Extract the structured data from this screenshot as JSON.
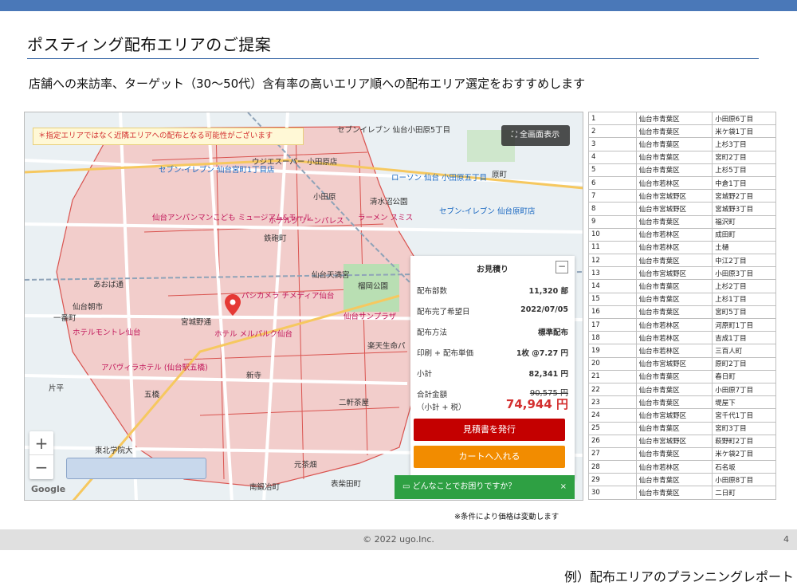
{
  "slide": {
    "title": "ポスティング配布エリアのご提案",
    "subtitle": "店舗への来訪率、ターゲット（30〜50代）含有率の高いエリア順への配布エリア選定をおすすめします",
    "note": "※条件により価格は変動します",
    "copyright": "© 2022 ugo.Inc.",
    "page_number": "4",
    "caption": "例）配布エリアのプランニングレポート",
    "accent_color": "#4a78b8"
  },
  "map": {
    "warning": "＊指定エリアではなく近隣エリアへの配布となる可能性がございます",
    "fullscreen_label": "全画面表示",
    "zoom_in": "+",
    "zoom_out": "−",
    "google_logo": "Google",
    "labels": [
      "セブンイレブン 仙台小田原5丁目",
      "ウジエスーパー 小田原店",
      "小田原",
      "清水沼公園",
      "ローソン 仙台 小田原五丁目",
      "原町",
      "セブン-イレブン 仙台宮町1丁目店",
      "仙台アンパンマンこども ミュージアム&モール",
      "ホテルグリーンパレス",
      "ラーメン スミス",
      "セブン-イレブン 仙台原町店",
      "榴岡公園",
      "仙台天満宮",
      "パシカメラ チメディア仙台",
      "宮城野通",
      "ホテル メルパルク仙台",
      "仙台サンプラザ",
      "ホテルモントレ仙台",
      "アパヴィラホテル (仙台駅五橋)",
      "楽天生命パ",
      "新寺",
      "二軒茶屋",
      "五橋",
      "東北学院大",
      "元茶畑",
      "表柴田町",
      "南鍛冶町",
      "一番町",
      "あおば通",
      "片平",
      "仙台朝市",
      "鉄砲町"
    ]
  },
  "quote": {
    "title": "お見積り",
    "minimize": "−",
    "rows": [
      {
        "label": "配布部数",
        "value": "11,320 部"
      },
      {
        "label": "配布完了希望日",
        "value": "2022/07/05"
      },
      {
        "label": "配布方法",
        "value": "標準配布"
      },
      {
        "label": "印刷 + 配布単価",
        "value": "1枚 @7.27 円"
      },
      {
        "label": "小計",
        "value": "82,341 円"
      }
    ],
    "total_label": "合計金額",
    "total_sub": "（小計 + 税）",
    "total_old": "90,575 円",
    "total": "74,944 円",
    "issue_button": "見積書を発行",
    "cart_button": "カートへ入れる",
    "help": "どんなことでお困りですか？",
    "help_close": "×"
  },
  "areas": [
    [
      "1",
      "仙台市青葉区",
      "小田原6丁目"
    ],
    [
      "2",
      "仙台市青葉区",
      "米ケ袋1丁目"
    ],
    [
      "3",
      "仙台市青葉区",
      "上杉3丁目"
    ],
    [
      "4",
      "仙台市青葉区",
      "宮町2丁目"
    ],
    [
      "5",
      "仙台市青葉区",
      "上杉5丁目"
    ],
    [
      "6",
      "仙台市若林区",
      "中倉1丁目"
    ],
    [
      "7",
      "仙台市宮城野区",
      "宮城野2丁目"
    ],
    [
      "8",
      "仙台市宮城野区",
      "宮城野3丁目"
    ],
    [
      "9",
      "仙台市青葉区",
      "福沢町"
    ],
    [
      "10",
      "仙台市若林区",
      "成田町"
    ],
    [
      "11",
      "仙台市若林区",
      "土樋"
    ],
    [
      "12",
      "仙台市青葉区",
      "中江2丁目"
    ],
    [
      "13",
      "仙台市宮城野区",
      "小田原3丁目"
    ],
    [
      "14",
      "仙台市青葉区",
      "上杉2丁目"
    ],
    [
      "15",
      "仙台市青葉区",
      "上杉1丁目"
    ],
    [
      "16",
      "仙台市青葉区",
      "宮町5丁目"
    ],
    [
      "17",
      "仙台市若林区",
      "河原町1丁目"
    ],
    [
      "18",
      "仙台市若林区",
      "吉成1丁目"
    ],
    [
      "19",
      "仙台市若林区",
      "三百人町"
    ],
    [
      "20",
      "仙台市宮城野区",
      "原町2丁目"
    ],
    [
      "21",
      "仙台市青葉区",
      "春日町"
    ],
    [
      "22",
      "仙台市青葉区",
      "小田原7丁目"
    ],
    [
      "23",
      "仙台市青葉区",
      "堤屋下"
    ],
    [
      "24",
      "仙台市宮城野区",
      "宮千代1丁目"
    ],
    [
      "25",
      "仙台市青葉区",
      "宮町3丁目"
    ],
    [
      "26",
      "仙台市宮城野区",
      "萩野町2丁目"
    ],
    [
      "27",
      "仙台市青葉区",
      "米ケ袋2丁目"
    ],
    [
      "28",
      "仙台市若林区",
      "石名坂"
    ],
    [
      "29",
      "仙台市青葉区",
      "小田原8丁目"
    ],
    [
      "30",
      "仙台市青葉区",
      "二日町"
    ]
  ]
}
